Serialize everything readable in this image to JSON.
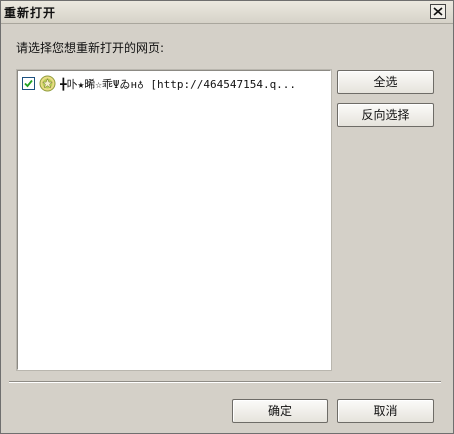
{
  "window": {
    "title": "重新打开",
    "close_icon": "close-icon"
  },
  "main": {
    "prompt": "请选择您想重新打开的网页:",
    "items": [
      {
        "checked": true,
        "icon": "site-favicon-icon",
        "label": "╋卟★晞☆乖Ψゐн♁ [http://464547154.q..."
      }
    ]
  },
  "buttons": {
    "select_all": "全选",
    "invert_selection": "反向选择",
    "ok": "确定",
    "cancel": "取消"
  },
  "colors": {
    "dialog_bg": "#d4d0c8",
    "list_bg": "#ffffff"
  }
}
